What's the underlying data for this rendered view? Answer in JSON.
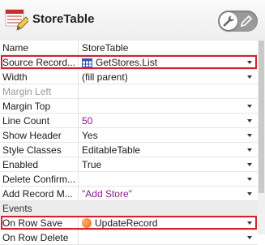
{
  "header": {
    "title": "StoreTable"
  },
  "properties": [
    {
      "name": "Name",
      "value": "StoreTable"
    },
    {
      "name": "Source Record...",
      "value": "GetStores.List",
      "icon": "table-grid-icon",
      "dropdown": true,
      "highlighted": true
    },
    {
      "name": "Width",
      "value": "(fill parent)",
      "dropdown": true
    },
    {
      "name": "Margin Left",
      "value": "",
      "muted": true
    },
    {
      "name": "Margin Top",
      "value": "",
      "dropdown": true
    },
    {
      "name": "Line Count",
      "value": "50",
      "purple": true,
      "dropdown": true
    },
    {
      "name": "Show Header",
      "value": "Yes",
      "dropdown": true
    },
    {
      "name": "Style Classes",
      "value": "EditableTable",
      "dropdown": true
    },
    {
      "name": "Enabled",
      "value": "True",
      "dropdown": true
    },
    {
      "name": "Delete Confirm...",
      "value": "",
      "dropdown": true
    },
    {
      "name": "Add Record M...",
      "value": "\"Add Store\"",
      "purple": true,
      "dropdown": true
    }
  ],
  "events_section": {
    "label": "Events"
  },
  "events": [
    {
      "name": "On Row Save",
      "value": "UpdateRecord",
      "icon": "orange-circle-icon",
      "dropdown": true,
      "highlighted": true
    },
    {
      "name": "On Row Delete",
      "value": "",
      "dropdown": true
    }
  ],
  "colors": {
    "highlight_border": "#d6202f",
    "purple_value": "#8b1a8b",
    "icon_red": "#c8312b",
    "orange_action": "#e86a10"
  }
}
